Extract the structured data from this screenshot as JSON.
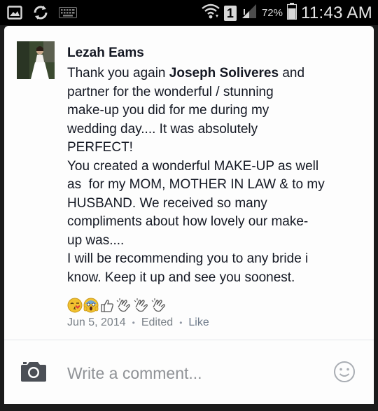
{
  "status_bar": {
    "sim_label": "1",
    "battery_percent": "72%",
    "time": "11:43 AM",
    "icons": [
      "gallery-icon",
      "sync-icon",
      "keyboard-icon",
      "wifi-icon",
      "sim-icon",
      "signal-icon",
      "battery-icon"
    ]
  },
  "comment": {
    "author": "Lezah Eams",
    "lines": {
      "l1_a": "Thank you again ",
      "l1_name": "Joseph Soliveres",
      "l1_b": " and",
      "l2": "partner for the wonderful / stunning",
      "l3": "make-up you did for me during my",
      "l4": "wedding day.... It was absolutely",
      "l5": "PERFECT!",
      "l6": "You created a wonderful MAKE-UP as well",
      "l7": "as  for my MOM, MOTHER IN LAW & to my",
      "l8": "HUSBAND. We received so many",
      "l9": "compliments about how lovely our make-",
      "l10": "up was....",
      "l11": "I will be recommending you to any bride i",
      "l12": "know. Keep it up and see you soonest."
    },
    "emojis": [
      "kissing-face-icon",
      "scream-face-icon",
      "thumbs-up-icon",
      "clapping-hands-icon",
      "clapping-hands-icon",
      "clapping-hands-icon"
    ],
    "meta": {
      "date": "Jun 5, 2014",
      "edited": "Edited",
      "like": "Like",
      "separator": "•"
    }
  },
  "composer": {
    "placeholder": "Write a comment...",
    "camera_icon": "camera-icon",
    "emoji_icon": "smiley-icon"
  },
  "colors": {
    "status_bar_bg": "#000000",
    "card_bg": "#fdfdfd",
    "text": "#141823",
    "meta_text": "#7a8188"
  }
}
